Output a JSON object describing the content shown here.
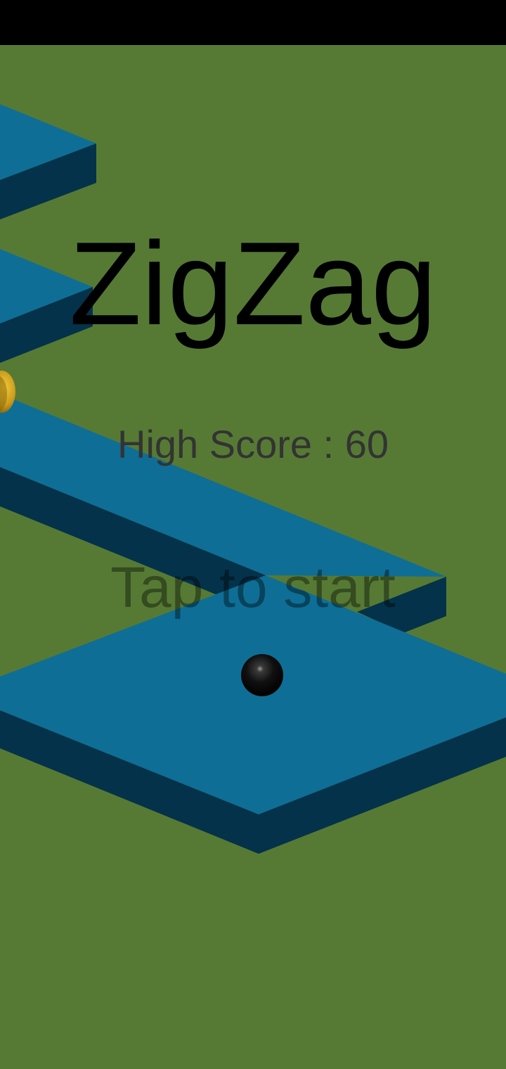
{
  "game": {
    "title": "ZigZag",
    "high_score_text": "High Score : 60",
    "prompt": "Tap to start"
  },
  "colors": {
    "background": "#567a34",
    "status_bar": "#000000",
    "platform_top": "#0e6e96",
    "platform_side": "#04324a",
    "ball": "#0a0a0a",
    "gem": "#c99a1a"
  }
}
